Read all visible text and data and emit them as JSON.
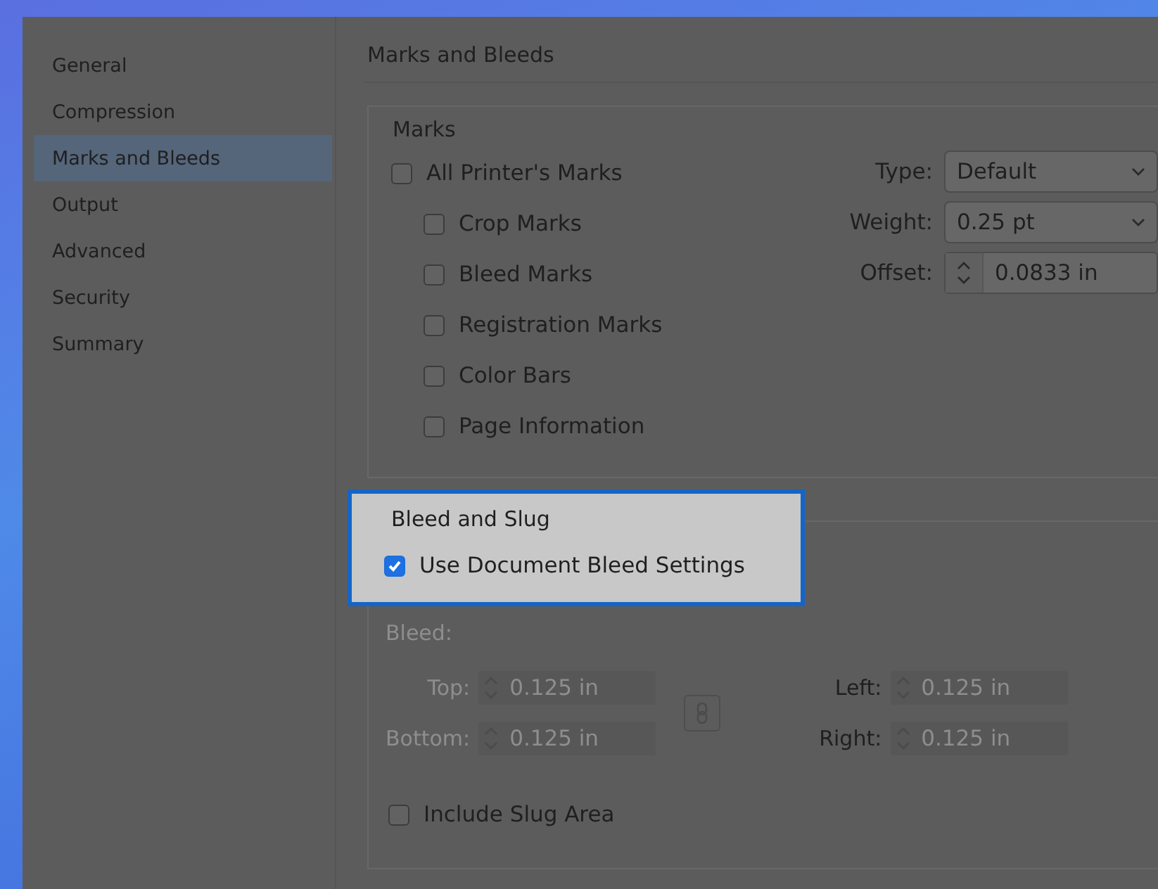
{
  "sidebar": {
    "items": [
      {
        "label": "General",
        "selected": false
      },
      {
        "label": "Compression",
        "selected": false
      },
      {
        "label": "Marks and Bleeds",
        "selected": true
      },
      {
        "label": "Output",
        "selected": false
      },
      {
        "label": "Advanced",
        "selected": false
      },
      {
        "label": "Security",
        "selected": false
      },
      {
        "label": "Summary",
        "selected": false
      }
    ]
  },
  "panel": {
    "title": "Marks and Bleeds",
    "marks": {
      "legend": "Marks",
      "checkboxes": [
        {
          "label": "All Printer's Marks",
          "checked": false,
          "children": [
            {
              "label": "Crop Marks",
              "checked": false
            },
            {
              "label": "Bleed Marks",
              "checked": false
            },
            {
              "label": "Registration Marks",
              "checked": false
            },
            {
              "label": "Color Bars",
              "checked": false
            },
            {
              "label": "Page Information",
              "checked": false
            }
          ]
        }
      ],
      "settings": [
        {
          "kind": "select",
          "label": "Type:",
          "value": "Default"
        },
        {
          "kind": "select",
          "label": "Weight:",
          "value": "0.25 pt"
        },
        {
          "kind": "spinner",
          "label": "Offset:",
          "value": "0.0833 in"
        }
      ]
    },
    "bleed_and_slug": {
      "legend": "Bleed and Slug",
      "highlighted": true,
      "use_document_bleed": {
        "label": "Use Document Bleed Settings",
        "checked": true
      },
      "bleed_label": "Bleed:",
      "bleed_disabled": true,
      "left_fields": [
        {
          "label": "Top:",
          "value": "0.125 in",
          "label_disabled": true
        },
        {
          "label": "Bottom:",
          "value": "0.125 in",
          "label_disabled": true
        }
      ],
      "right_fields": [
        {
          "label": "Left:",
          "value": "0.125 in",
          "label_disabled": false
        },
        {
          "label": "Right:",
          "value": "0.125 in",
          "label_disabled": false
        }
      ],
      "include_slug": {
        "label": "Include Slug Area",
        "checked": false
      }
    }
  }
}
